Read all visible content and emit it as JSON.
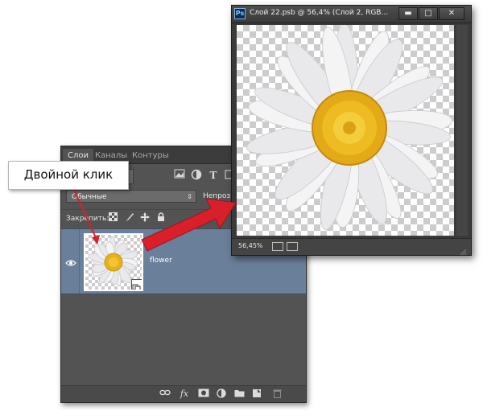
{
  "layers_panel": {
    "tabs": [
      "Слои",
      "Каналы",
      "Контуры"
    ],
    "filter_icons": [
      "image-filter-icon",
      "adjustment-filter-icon",
      "type-filter-icon"
    ],
    "blend_mode": "Обычные",
    "opacity_label": "Непрозр",
    "lock_label": "Закрепить:",
    "lock_icons": [
      "lock-transparent-icon",
      "lock-image-icon",
      "lock-position-icon",
      "lock-all-icon"
    ],
    "layer": {
      "name": "flower",
      "visible": true,
      "type": "smart-object"
    },
    "footer_icons": [
      "link-icon",
      "fx-icon",
      "mask-icon",
      "adjustment-icon",
      "folder-icon",
      "new-layer-icon",
      "trash-icon"
    ],
    "footer_fx": "fx"
  },
  "document_window": {
    "title": "Слой 22.psb @ 56,4% (Слой 2, RGB...",
    "app_badge": "Ps",
    "buttons": [
      "minimize",
      "maximize",
      "close"
    ],
    "zoom": "56,45%"
  },
  "annotation": {
    "callout_text": "Двойной клик",
    "arrow_color": "#d9202a"
  },
  "colors": {
    "panel_bg": "#535353",
    "selected_layer": "#6a7f99",
    "arrow": "#d9202a",
    "flower_center": "#e6b21c",
    "petal": "#f4f4f4"
  }
}
